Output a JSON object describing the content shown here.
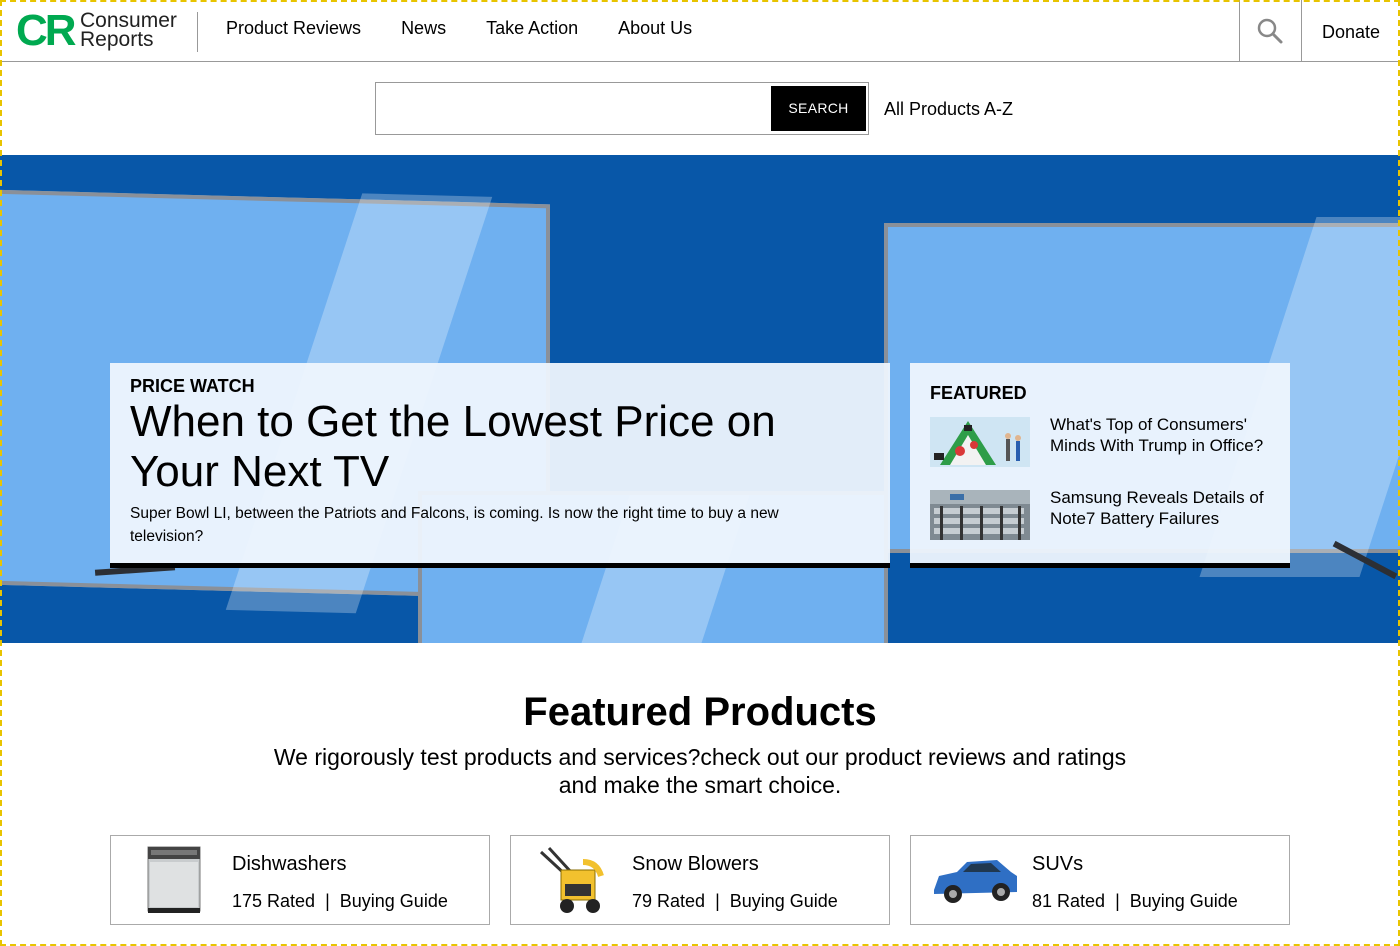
{
  "header": {
    "logo_mark": "CR",
    "logo_line1": "Consumer",
    "logo_line2": "Reports",
    "nav": [
      "Product Reviews",
      "News",
      "Take Action",
      "About Us"
    ],
    "donate": "Donate"
  },
  "search": {
    "placeholder": "",
    "button": "SEARCH",
    "all_products": "All Products A-Z"
  },
  "hero": {
    "kicker": "PRICE WATCH",
    "title": "When to Get the Lowest Price on Your Next TV",
    "description": "Super Bowl LI, between the Patriots and Falcons, is coming. Is now the right time to buy a new television?"
  },
  "featured": {
    "heading": "FEATURED",
    "items": [
      {
        "title": "What's Top of Consumers' Minds With Trump in Office?"
      },
      {
        "title": "Samsung Reveals Details of Note7 Battery Failures"
      }
    ]
  },
  "featured_products": {
    "title": "Featured Products",
    "subtitle": "We rigorously test products and services?check out our product reviews and ratings and make the smart choice.",
    "separator": "|",
    "items": [
      {
        "name": "Dishwashers",
        "rated": "175 Rated",
        "guide": "Buying Guide",
        "icon": "dishwasher-icon"
      },
      {
        "name": "Snow Blowers",
        "rated": "79 Rated",
        "guide": "Buying Guide",
        "icon": "snow-blower-icon"
      },
      {
        "name": "SUVs",
        "rated": "81 Rated",
        "guide": "Buying Guide",
        "icon": "suv-icon"
      }
    ]
  },
  "colors": {
    "brand_green": "#00a950",
    "hero_blue": "#0857a8",
    "screen_blue": "#6fb0f0"
  }
}
